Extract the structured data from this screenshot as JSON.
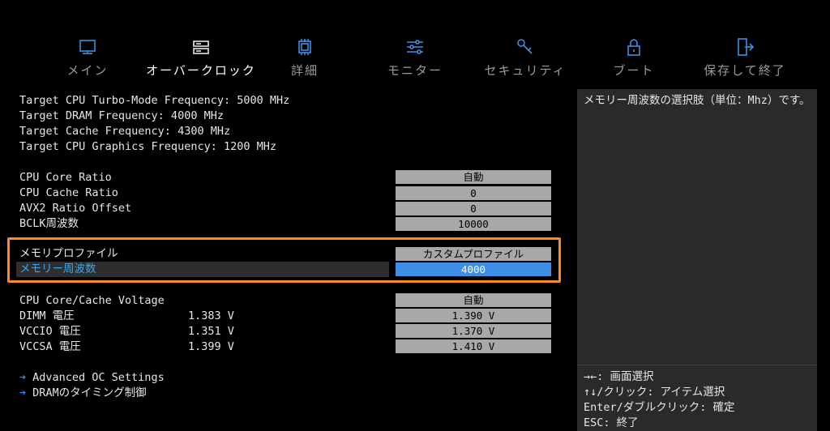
{
  "nav": [
    {
      "label": "メイン",
      "icon": "main-icon"
    },
    {
      "label": "オーバークロック",
      "icon": "overclock-icon"
    },
    {
      "label": "詳細",
      "icon": "chip-icon"
    },
    {
      "label": "モニター",
      "icon": "sliders-icon"
    },
    {
      "label": "セキュリティ",
      "icon": "key-icon"
    },
    {
      "label": "ブート",
      "icon": "lock-icon"
    },
    {
      "label": "保存して終了",
      "icon": "exit-door-icon"
    }
  ],
  "targets": [
    "Target CPU Turbo-Mode Frequency: 5000 MHz",
    "Target DRAM Frequency: 4000 MHz",
    "Target Cache Frequency: 4300 MHz",
    "Target CPU Graphics Frequency: 1200 MHz"
  ],
  "ratios": [
    {
      "label": "CPU Core Ratio",
      "value": "自動"
    },
    {
      "label": "CPU Cache Ratio",
      "value": "0"
    },
    {
      "label": "AVX2 Ratio Offset",
      "value": "0"
    },
    {
      "label": "BCLK周波数",
      "value": "10000"
    }
  ],
  "memory": {
    "profile_label": "メモリプロファイル",
    "profile_value": "カスタムプロファイル",
    "freq_label": "メモリー周波数",
    "freq_value": "4000"
  },
  "voltages": [
    {
      "label": "CPU Core/Cache Voltage",
      "current": "",
      "value": "自動"
    },
    {
      "label": "DIMM 電圧",
      "current": "1.383 V",
      "value": "1.390 V"
    },
    {
      "label": "VCCIO 電圧",
      "current": "1.351 V",
      "value": "1.370 V"
    },
    {
      "label": "VCCSA 電圧",
      "current": "1.399 V",
      "value": "1.410 V"
    }
  ],
  "links": [
    "Advanced OC Settings",
    "DRAMのタイミング制御"
  ],
  "help": {
    "description": "メモリー周波数の選択肢（単位：Mhz）です。",
    "keys": [
      "→←: 画面選択",
      "↑↓/クリック: アイテム選択",
      "Enter/ダブルクリック: 確定",
      "ESC: 終了"
    ]
  },
  "colors": {
    "highlight": "#ff8a1e",
    "accent": "#3d8fe6",
    "value_box": "#a8a8a8",
    "panel": "#2a2a2a"
  }
}
